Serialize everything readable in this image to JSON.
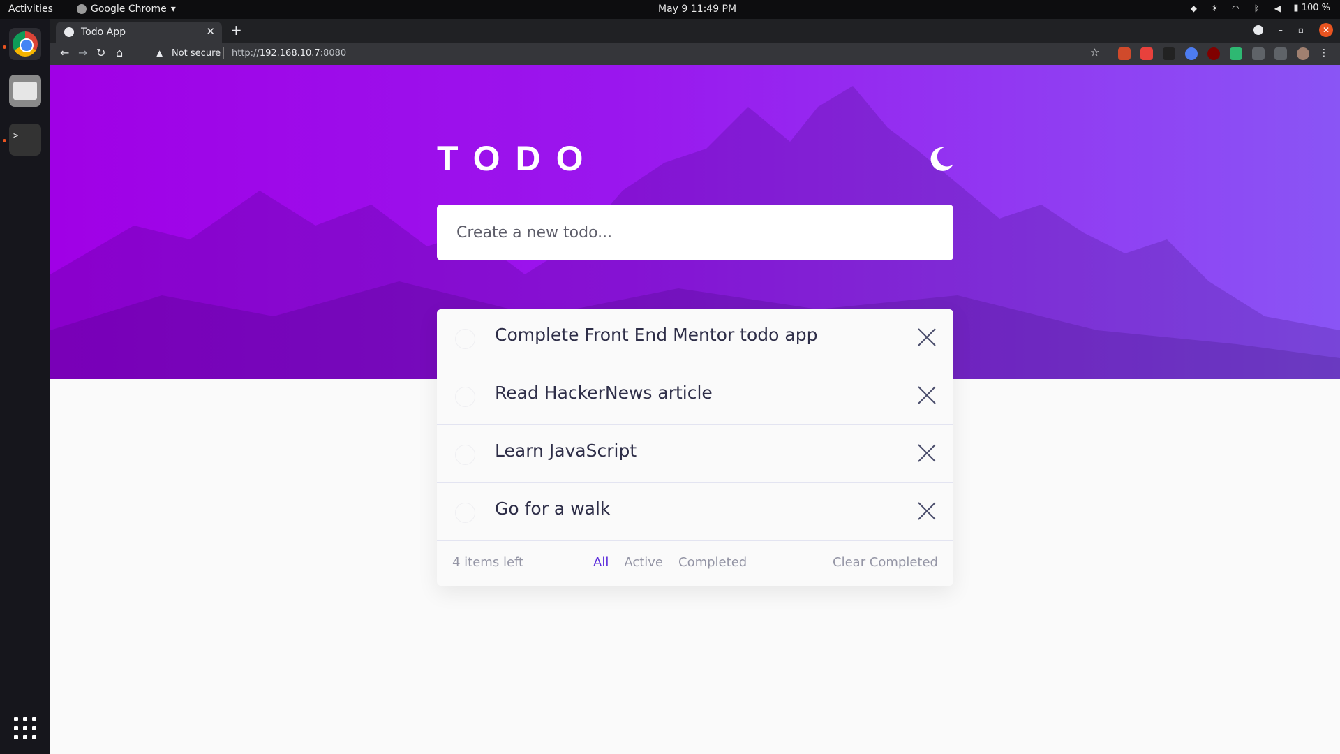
{
  "desktop": {
    "activities": "Activities",
    "app_menu": "Google Chrome",
    "clock": "May 9  11:49 PM",
    "battery": "100 %"
  },
  "browser": {
    "tab_title": "Todo App",
    "security_label": "Not secure",
    "url_scheme": "http://",
    "url_host": "192.168.10.7",
    "url_port": ":8080"
  },
  "app": {
    "logo": "TODO",
    "theme_icon": "moon-icon",
    "new_todo_placeholder": "Create a new todo...",
    "todos": [
      {
        "text": "Complete Front End Mentor todo app",
        "completed": false
      },
      {
        "text": "Read HackerNews article",
        "completed": false
      },
      {
        "text": "Learn JavaScript",
        "completed": false
      },
      {
        "text": "Go for a walk",
        "completed": false
      }
    ],
    "footer": {
      "items_left": "4 items left",
      "filters": [
        "All",
        "Active",
        "Completed"
      ],
      "active_filter": "All",
      "clear_label": "Clear Completed"
    }
  },
  "colors": {
    "hero_start": "#a000e6",
    "hero_end": "#8a55f5",
    "active_filter": "#5a2bdb",
    "todo_text": "#2e2e48"
  }
}
